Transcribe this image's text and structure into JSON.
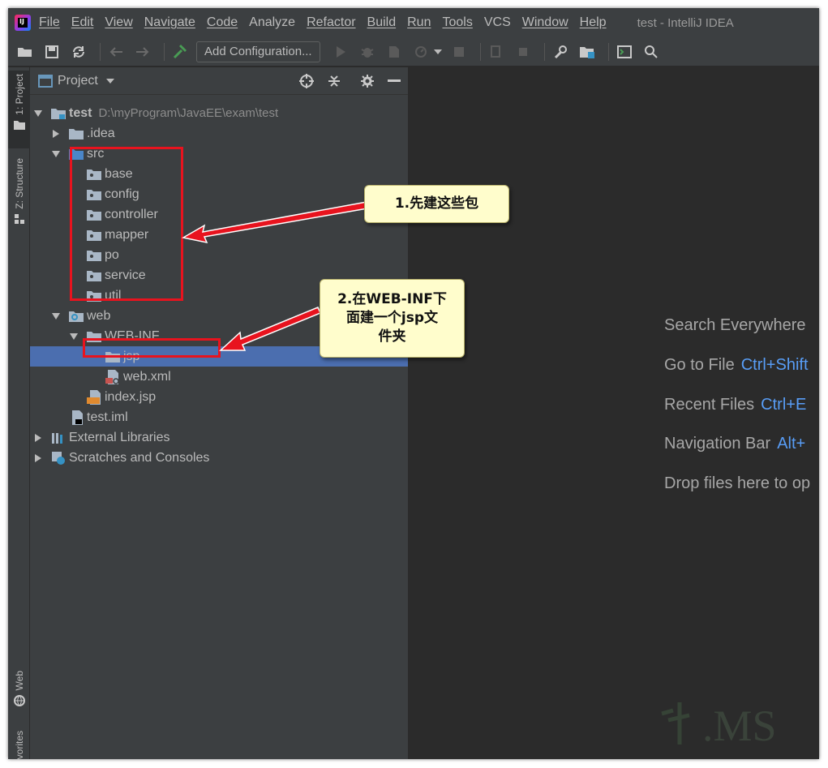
{
  "window": {
    "title": "test - IntelliJ IDEA",
    "menu": [
      "File",
      "Edit",
      "View",
      "Navigate",
      "Code",
      "Analyze",
      "Refactor",
      "Build",
      "Run",
      "Tools",
      "VCS",
      "Window",
      "Help"
    ]
  },
  "toolbar": {
    "add_configuration_label": "Add Configuration..."
  },
  "left_strip": {
    "project_tab": "1: Project",
    "structure_tab": "Z: Structure",
    "web_tab": "Web",
    "favorites_tab": "vorites"
  },
  "project_panel": {
    "title": "Project",
    "tree": [
      {
        "label": "test",
        "path": "D:\\myProgram\\JavaEE\\exam\\test"
      },
      {
        "label": ".idea"
      },
      {
        "label": "src"
      },
      {
        "label": "base"
      },
      {
        "label": "config"
      },
      {
        "label": "controller"
      },
      {
        "label": "mapper"
      },
      {
        "label": "po"
      },
      {
        "label": "service"
      },
      {
        "label": "util"
      },
      {
        "label": "web"
      },
      {
        "label": "WEB-INF"
      },
      {
        "label": "jsp"
      },
      {
        "label": "web.xml"
      },
      {
        "label": "index.jsp"
      },
      {
        "label": "test.iml"
      },
      {
        "label": "External Libraries"
      },
      {
        "label": "Scratches and Consoles"
      }
    ]
  },
  "editor_hints": [
    {
      "label": "Search Everywhere",
      "key": ""
    },
    {
      "label": "Go to File",
      "key": "Ctrl+Shift"
    },
    {
      "label": "Recent Files",
      "key": "Ctrl+E"
    },
    {
      "label": "Navigation Bar",
      "key": "Alt+"
    },
    {
      "label": "Drop files here to op",
      "key": ""
    }
  ],
  "annotations": {
    "callout1": "1.先建这些包",
    "callout2_line1": "2.在WEB-INF下",
    "callout2_line2": "面建一个jsp文",
    "callout2_line3": "件夹"
  },
  "watermark_text": ".MS",
  "colors": {
    "chrome": "#3c3f41",
    "editor": "#2b2b2b",
    "selection": "#4b6eaf",
    "annotation_red": "#e8131e",
    "callout_bg": "#fffdcc",
    "shortcut_blue": "#589df6"
  }
}
